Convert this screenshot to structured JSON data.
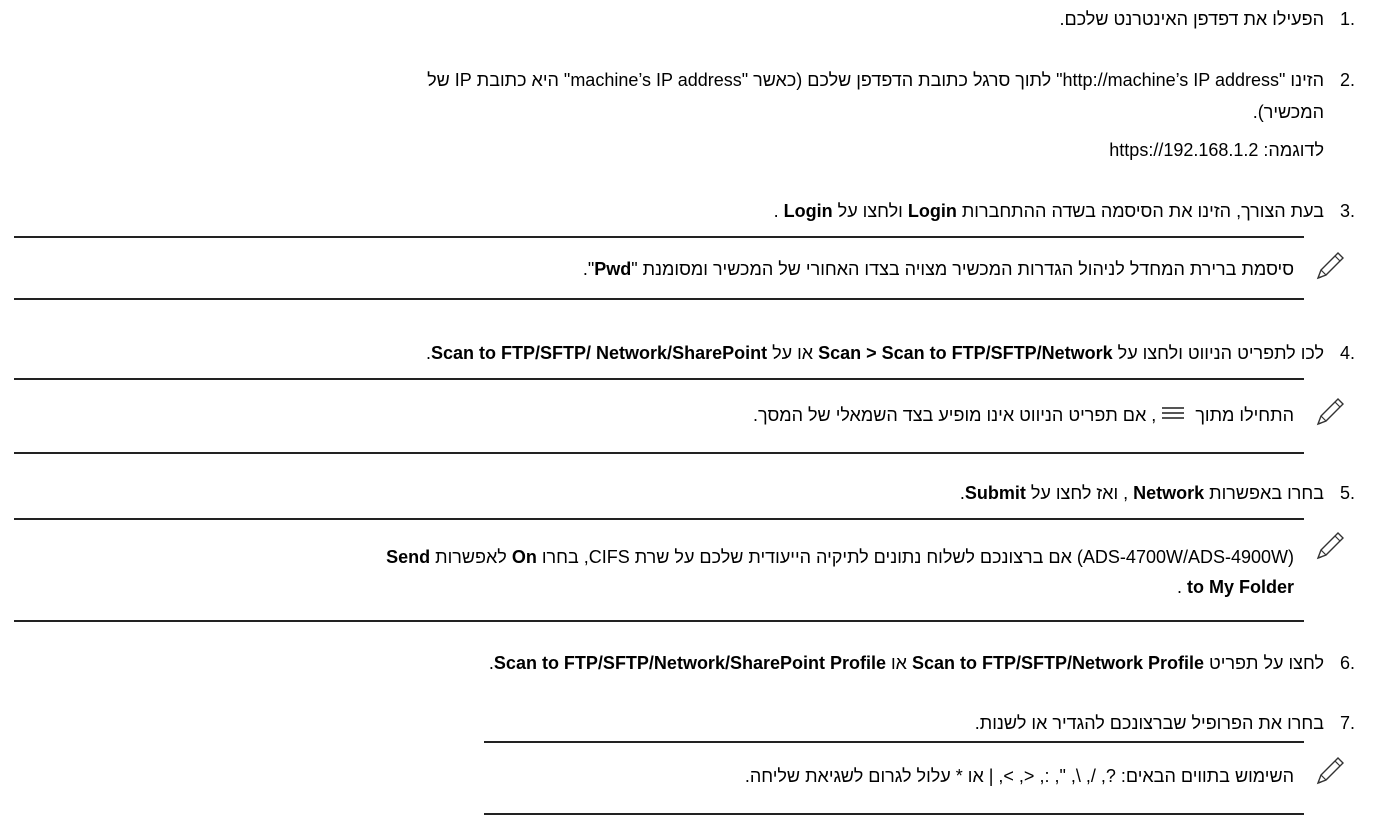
{
  "steps": [
    {
      "num": "1.",
      "text": "הפעילו את דפדפן האינטרנט שלכם."
    },
    {
      "num": "2.",
      "line1": "הזינו \"http://machine’s IP address\" לתוך סרגל כתובת הדפדפן שלכם (כאשר \"machine’s IP address\" היא כתובת IP של",
      "line2": "המכשיר).",
      "example": "לדוגמה: https://192.168.1.2"
    },
    {
      "num": "3.",
      "a": "בעת הצורך, הזינו את הסיסמה בשדה ההתחברות ",
      "login_field": "Login",
      "b": " ולחצו על ",
      "login_btn": "Login",
      "c": " ."
    },
    {
      "num": "4.",
      "a": "לכו לתפריט הניווט ולחצו על ",
      "path": "Scan > Scan to FTP/SFTP/Network",
      "b": " או על ",
      "path2": "Scan to FTP/SFTP/ Network/SharePoint",
      "c": "."
    },
    {
      "num": "5.",
      "a": "בחרו באפשרות ",
      "opt": "Network",
      "b": " , ואז לחצו על ",
      "submit": "Submit",
      "c": "."
    },
    {
      "num": "6.",
      "a": "לחצו על תפריט ",
      "p1": "Scan to FTP/SFTP/Network Profile",
      "b": " או ",
      "p2": "Scan to FTP/SFTP/Network/SharePoint Profile",
      "c": "."
    },
    {
      "num": "7.",
      "text": "בחרו את הפרופיל שברצונכם להגדיר או לשנות."
    }
  ],
  "notes": {
    "pwd": {
      "a": "סיסמת ברירת המחדל לניהול הגדרות המכשיר מצויה בצדו האחורי של המכשיר ומסומנת \"",
      "b": "Pwd",
      "c": "\"."
    },
    "nav": {
      "a": "התחילו מתוך ",
      "b": ", אם תפריט הניווט אינו מופיע בצד השמאלי של המסך."
    },
    "cifs": {
      "a": "(ADS-4700W/ADS-4900W) אם ברצונכם לשלוח נתונים לתיקיה הייעודית שלכם על שרת CIFS, בחרו ",
      "on": "On",
      "b": " לאפשרות ",
      "send": "Send",
      "to_folder": "to My Folder",
      "c": " ."
    },
    "chars": {
      "text": "השימוש בתווים הבאים: ?, /, \\, \", :, <, >, | או * עלול לגרום לשגיאת שליחה."
    }
  },
  "icons": {
    "note": "pencil-icon",
    "menu": "hamburger-menu-icon"
  }
}
